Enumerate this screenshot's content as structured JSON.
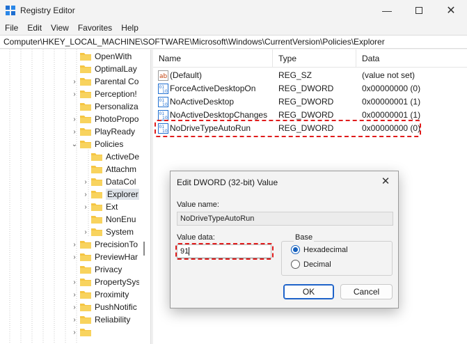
{
  "window": {
    "title": "Registry Editor",
    "min_icon": "minimize-icon",
    "max_icon": "maximize-icon",
    "close_icon": "close-icon"
  },
  "menu": [
    "File",
    "Edit",
    "View",
    "Favorites",
    "Help"
  ],
  "address": "Computer\\HKEY_LOCAL_MACHINE\\SOFTWARE\\Microsoft\\Windows\\CurrentVersion\\Policies\\Explorer",
  "tree": {
    "items": [
      {
        "label": "OpenWith",
        "chev": ""
      },
      {
        "label": "OptimalLay",
        "chev": ""
      },
      {
        "label": "Parental Co",
        "chev": "›"
      },
      {
        "label": "Perception!",
        "chev": "›"
      },
      {
        "label": "Personaliza",
        "chev": ""
      },
      {
        "label": "PhotoPropo",
        "chev": "›"
      },
      {
        "label": "PlayReady",
        "chev": "›"
      },
      {
        "label": "Policies",
        "chev": "⌄"
      },
      {
        "label": "ActiveDe",
        "chev": ""
      },
      {
        "label": "Attachm",
        "chev": ""
      },
      {
        "label": "DataCol",
        "chev": "›"
      },
      {
        "label": "Explorer",
        "chev": "›"
      },
      {
        "label": "Ext",
        "chev": "›"
      },
      {
        "label": "NonEnu",
        "chev": ""
      },
      {
        "label": "System",
        "chev": "›"
      },
      {
        "label": "PrecisionTo",
        "chev": "›"
      },
      {
        "label": "PreviewHar",
        "chev": "›"
      },
      {
        "label": "Privacy",
        "chev": ""
      },
      {
        "label": "PropertySys",
        "chev": "›"
      },
      {
        "label": "Proximity",
        "chev": "›"
      },
      {
        "label": "PushNotific",
        "chev": "›"
      },
      {
        "label": "Reliability",
        "chev": "›"
      },
      {
        "label": "",
        "chev": "›"
      }
    ]
  },
  "list": {
    "columns": [
      "Name",
      "Type",
      "Data"
    ],
    "rows": [
      {
        "name": "(Default)",
        "type": "REG_SZ",
        "data": "(value not set)",
        "icon": "string-value-icon"
      },
      {
        "name": "ForceActiveDesktopOn",
        "type": "REG_DWORD",
        "data": "0x00000000 (0)",
        "icon": "dword-value-icon"
      },
      {
        "name": "NoActiveDesktop",
        "type": "REG_DWORD",
        "data": "0x00000001 (1)",
        "icon": "dword-value-icon"
      },
      {
        "name": "NoActiveDesktopChanges",
        "type": "REG_DWORD",
        "data": "0x00000001 (1)",
        "icon": "dword-value-icon"
      },
      {
        "name": "NoDriveTypeAutoRun",
        "type": "REG_DWORD",
        "data": "0x00000000 (0)",
        "icon": "dword-value-icon"
      }
    ]
  },
  "dialog": {
    "title": "Edit DWORD (32-bit) Value",
    "value_name_label": "Value name:",
    "value_name": "NoDriveTypeAutoRun",
    "value_data_label": "Value data:",
    "value_data": "91",
    "base_label": "Base",
    "hex_label": "Hexadecimal",
    "dec_label": "Decimal",
    "ok": "OK",
    "cancel": "Cancel",
    "selected_base": "Hexadecimal"
  },
  "colors": {
    "highlight_dash": "#e01b1b",
    "folder": "#f5c542",
    "accent": "#1560bd"
  }
}
